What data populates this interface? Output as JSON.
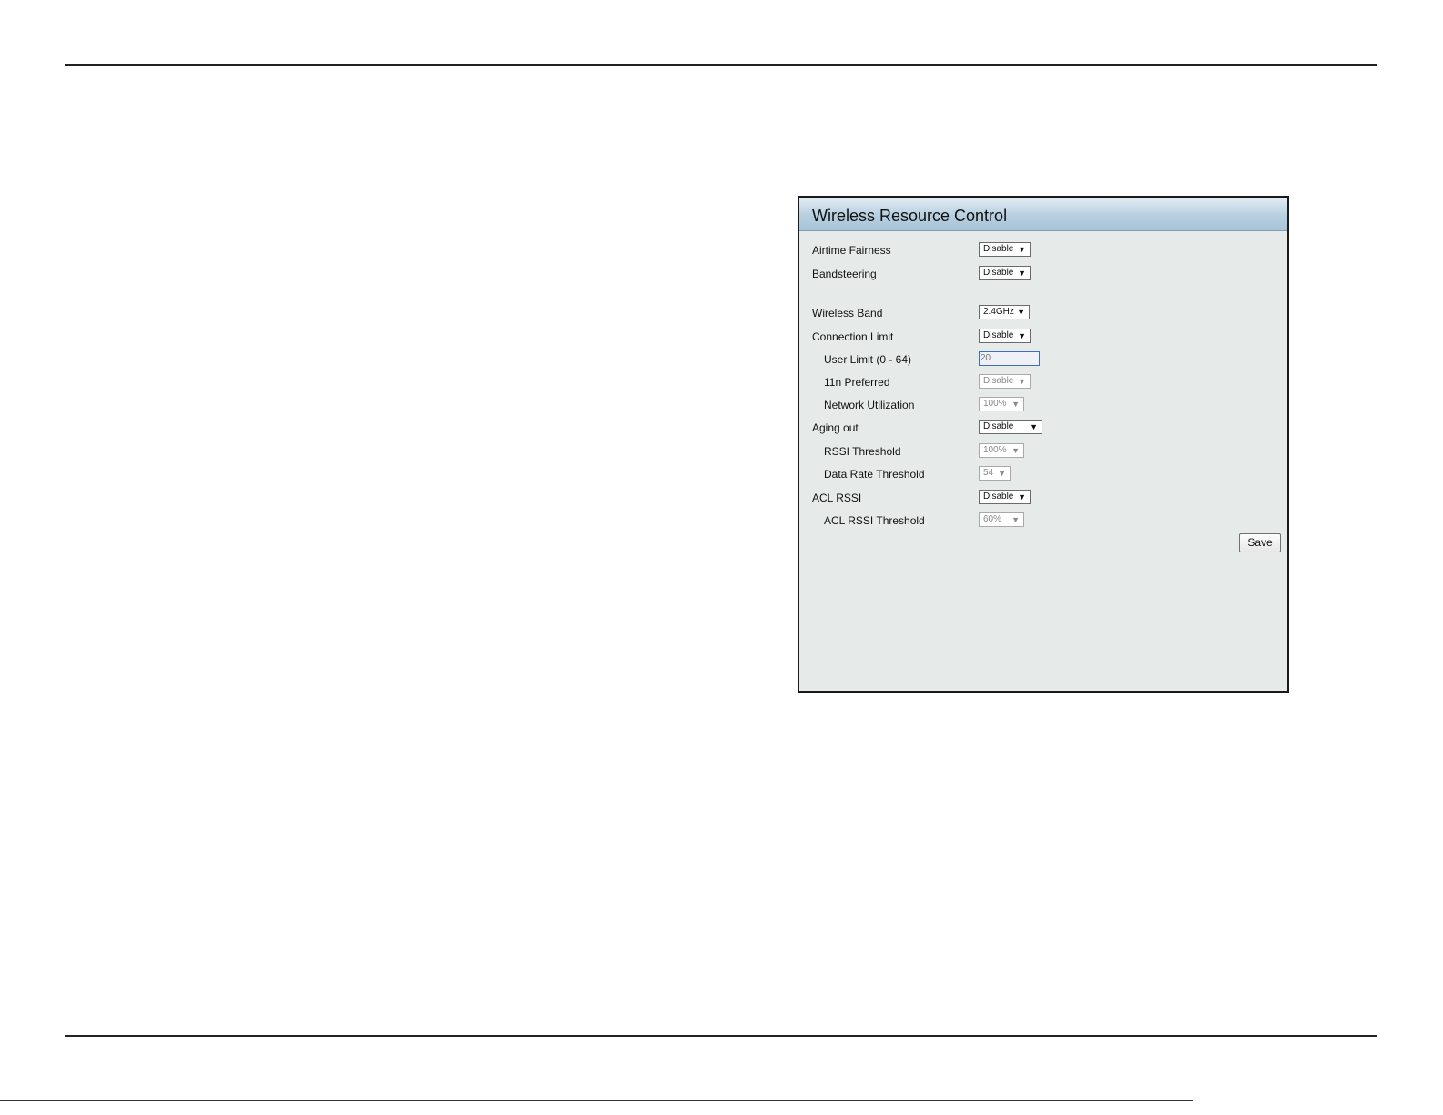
{
  "panel": {
    "title": "Wireless Resource Control"
  },
  "fields": {
    "airtime_fairness": {
      "label": "Airtime Fairness",
      "value": "Disable"
    },
    "bandsteering": {
      "label": "Bandsteering",
      "value": "Disable"
    },
    "wireless_band": {
      "label": "Wireless Band",
      "value": "2.4GHz"
    },
    "connection_limit": {
      "label": "Connection Limit",
      "value": "Disable"
    },
    "user_limit": {
      "label": "User Limit (0 - 64)",
      "value": "20"
    },
    "n11_preferred": {
      "label": "11n Preferred",
      "value": "Disable"
    },
    "network_utilization": {
      "label": "Network Utilization",
      "value": "100%"
    },
    "aging_out": {
      "label": "Aging out",
      "value": "Disable"
    },
    "rssi_threshold": {
      "label": "RSSI Threshold",
      "value": "100%"
    },
    "data_rate_threshold": {
      "label": "Data Rate Threshold",
      "value": "54"
    },
    "acl_rssi": {
      "label": "ACL RSSI",
      "value": "Disable"
    },
    "acl_rssi_threshold": {
      "label": "ACL RSSI Threshold",
      "value": "60%"
    }
  },
  "buttons": {
    "save_label": "Save"
  },
  "icons": {
    "dropdown": "chevron-down-icon"
  }
}
